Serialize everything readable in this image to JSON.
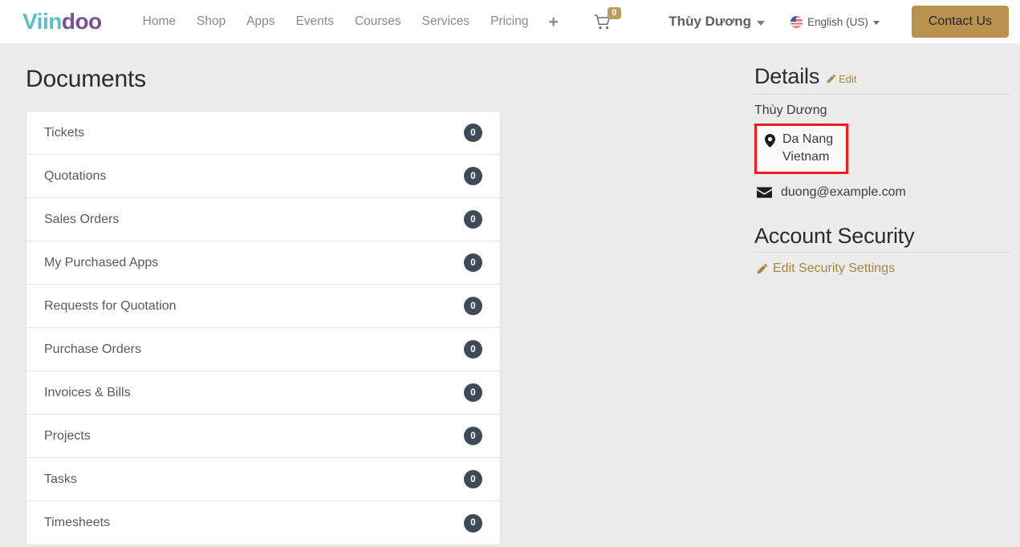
{
  "header": {
    "brand": {
      "part1": "Viin",
      "part2": "doo",
      "color1": "#5bc0c6",
      "color2": "#7d4f96"
    },
    "nav_links": [
      {
        "label": "Home"
      },
      {
        "label": "Shop"
      },
      {
        "label": "Apps"
      },
      {
        "label": "Events"
      },
      {
        "label": "Courses"
      },
      {
        "label": "Services"
      },
      {
        "label": "Pricing"
      }
    ],
    "plus_label": "+",
    "cart": {
      "icon": "shopping-cart-icon",
      "count": "0",
      "badge_color": "#bf9b5d"
    },
    "user_menu": {
      "label": "Thùy Dương",
      "icon": "chevron-down-icon"
    },
    "language_menu": {
      "label": "English (US)",
      "flag": "us-flag-icon",
      "icon": "chevron-down-icon"
    },
    "contact_button": {
      "label": "Contact Us",
      "color": "#b8924e"
    }
  },
  "main": {
    "title": "Documents",
    "documents": [
      {
        "label": "Tickets",
        "count": "0"
      },
      {
        "label": "Quotations",
        "count": "0"
      },
      {
        "label": "Sales Orders",
        "count": "0"
      },
      {
        "label": "My Purchased Apps",
        "count": "0"
      },
      {
        "label": "Requests for Quotation",
        "count": "0"
      },
      {
        "label": "Purchase Orders",
        "count": "0"
      },
      {
        "label": "Invoices & Bills",
        "count": "0"
      },
      {
        "label": "Projects",
        "count": "0"
      },
      {
        "label": "Tasks",
        "count": "0"
      },
      {
        "label": "Timesheets",
        "count": "0"
      }
    ],
    "badge_color": "#3f4a59"
  },
  "details": {
    "title": "Details",
    "edit_label": "Edit",
    "edit_icon": "pencil-icon",
    "name": "Thùy Dương",
    "address": {
      "icon": "map-pin-icon",
      "city": "Da Nang",
      "country": "Vietnam",
      "highlight_color": "#ee1c1c"
    },
    "email": {
      "icon": "envelope-icon",
      "value": "duong@example.com"
    }
  },
  "account_security": {
    "title": "Account Security",
    "link_label": "Edit Security Settings",
    "link_icon": "pencil-icon",
    "link_color": "#a9853f"
  }
}
